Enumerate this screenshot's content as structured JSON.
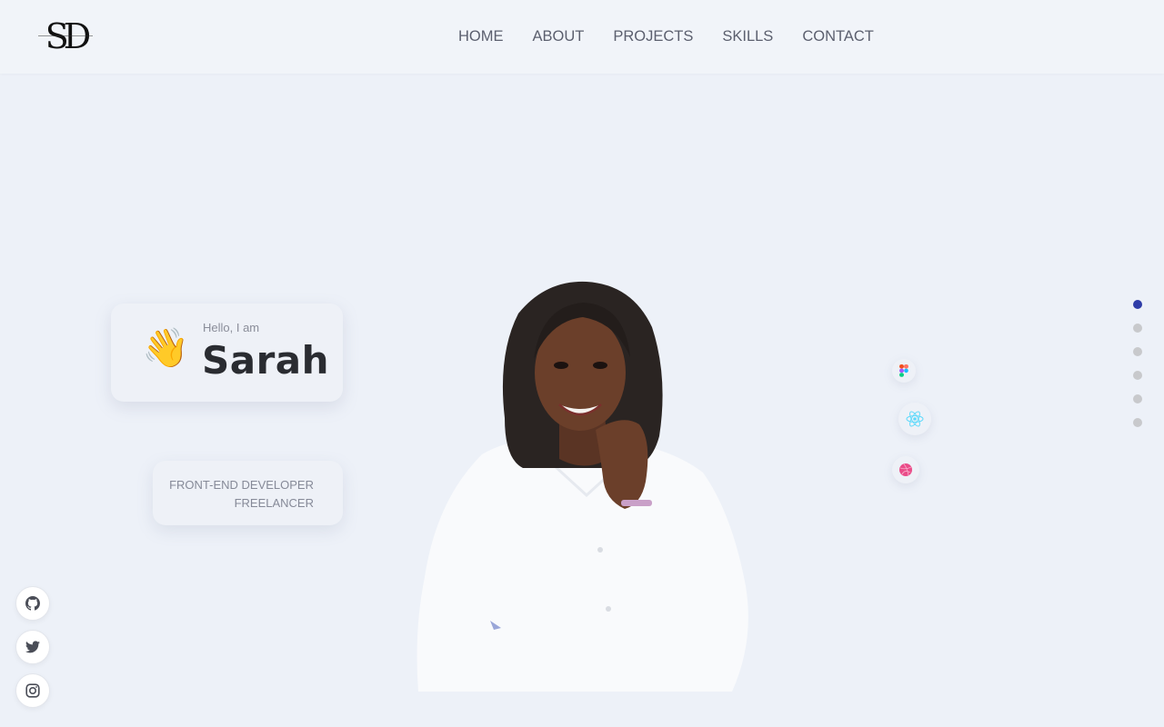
{
  "brand": {
    "logo_text": "SD"
  },
  "nav": {
    "items": [
      "HOME",
      "ABOUT",
      "PROJECTS",
      "SKILLS",
      "CONTACT"
    ]
  },
  "intro": {
    "greeting": "Hello, I am",
    "name": "Sarah",
    "wave_emoji": "👋"
  },
  "role": {
    "line1": "FRONT-END DEVELOPER",
    "line2": "FREELANCER"
  },
  "tech_icons": [
    "figma-icon",
    "react-icon",
    "dribbble-icon"
  ],
  "pagination": {
    "count": 6,
    "active_index": 0
  },
  "social": [
    "github-icon",
    "twitter-icon",
    "instagram-icon"
  ],
  "colors": {
    "background": "#edf1f8",
    "accent": "#2f3da8",
    "dot_inactive": "#c8c9cc"
  }
}
